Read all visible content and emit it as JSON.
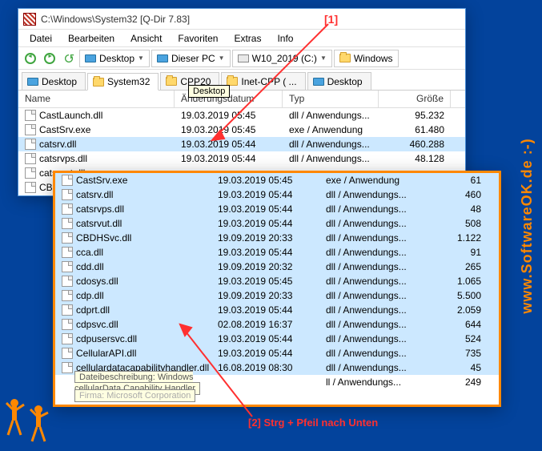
{
  "titlebar": "C:\\Windows\\System32  [Q-Dir 7.83]",
  "menu": [
    "Datei",
    "Bearbeiten",
    "Ansicht",
    "Favoriten",
    "Extras",
    "Info"
  ],
  "toolbar": {
    "desktop": "Desktop",
    "thispc": "Dieser PC",
    "drive": "W10_2019 (C:)",
    "windows": "Windows"
  },
  "tabs": [
    "Desktop",
    "System32",
    "CPP20",
    "Inet-CPP ( ...",
    "Desktop"
  ],
  "tooltip": "Desktop",
  "columns": {
    "name": "Name",
    "date": "Änderungsdatum",
    "type": "Typ",
    "size": "Größe"
  },
  "main_rows": [
    {
      "name": "CastLaunch.dll",
      "date": "19.03.2019 05:45",
      "type": "dll / Anwendungs...",
      "size": "95.232"
    },
    {
      "name": "CastSrv.exe",
      "date": "19.03.2019 05:45",
      "type": "exe / Anwendung",
      "size": "61.480"
    },
    {
      "name": "catsrv.dll",
      "date": "19.03.2019 05:44",
      "type": "dll / Anwendungs...",
      "size": "460.288",
      "selected": true
    },
    {
      "name": "catsrvps.dll",
      "date": "19.03.2019 05:44",
      "type": "dll / Anwendungs...",
      "size": "48.128"
    },
    {
      "name": "catsrvut.dll",
      "date": "",
      "type": "",
      "size": ""
    },
    {
      "name": "CBDHSvc.dll",
      "date": "",
      "type": "",
      "size": ""
    }
  ],
  "secondary_rows": [
    {
      "name": "CastSrv.exe",
      "date": "19.03.2019 05:45",
      "type": "exe / Anwendung",
      "size": "61"
    },
    {
      "name": "catsrv.dll",
      "date": "19.03.2019 05:44",
      "type": "dll / Anwendungs...",
      "size": "460"
    },
    {
      "name": "catsrvps.dll",
      "date": "19.03.2019 05:44",
      "type": "dll / Anwendungs...",
      "size": "48"
    },
    {
      "name": "catsrvut.dll",
      "date": "19.03.2019 05:44",
      "type": "dll / Anwendungs...",
      "size": "508"
    },
    {
      "name": "CBDHSvc.dll",
      "date": "19.09.2019 20:33",
      "type": "dll / Anwendungs...",
      "size": "1.122"
    },
    {
      "name": "cca.dll",
      "date": "19.03.2019 05:44",
      "type": "dll / Anwendungs...",
      "size": "91"
    },
    {
      "name": "cdd.dll",
      "date": "19.09.2019 20:32",
      "type": "dll / Anwendungs...",
      "size": "265"
    },
    {
      "name": "cdosys.dll",
      "date": "19.03.2019 05:45",
      "type": "dll / Anwendungs...",
      "size": "1.065"
    },
    {
      "name": "cdp.dll",
      "date": "19.09.2019 20:33",
      "type": "dll / Anwendungs...",
      "size": "5.500"
    },
    {
      "name": "cdprt.dll",
      "date": "19.03.2019 05:44",
      "type": "dll / Anwendungs...",
      "size": "2.059"
    },
    {
      "name": "cdpsvc.dll",
      "date": "02.08.2019 16:37",
      "type": "dll / Anwendungs...",
      "size": "644"
    },
    {
      "name": "cdpusersvc.dll",
      "date": "19.03.2019 05:44",
      "type": "dll / Anwendungs...",
      "size": "524"
    },
    {
      "name": "CellularAPI.dll",
      "date": "19.03.2019 05:44",
      "type": "dll / Anwendungs...",
      "size": "735"
    },
    {
      "name": "cellulardatacapabilityhandler.dll",
      "date": "16.08.2019 08:30",
      "type": "dll / Anwendungs...",
      "size": "45"
    }
  ],
  "secondary_tooltip": "Dateibeschreibung: Windows cellularData Capability Handler",
  "secondary_tooltip2": "Firma: Microsoft Corporation",
  "secondary_tail": {
    "type": "ll / Anwendungs...",
    "size": "249"
  },
  "annotation1": "[1]",
  "annotation2": "[2] Strg + Pfeil nach Unten",
  "watermark": "www.SoftwareOK.de :-)"
}
